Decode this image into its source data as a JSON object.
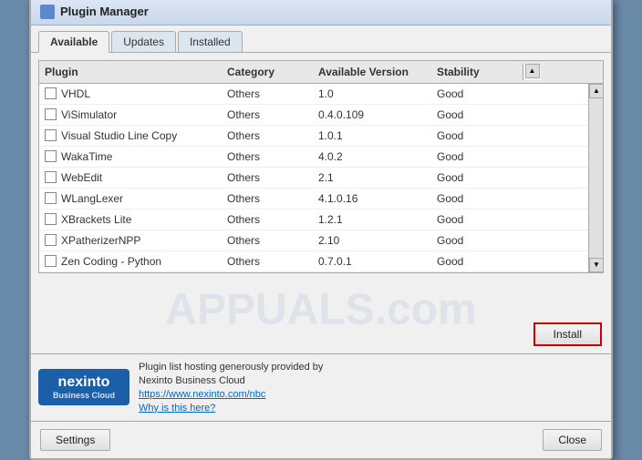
{
  "dialog": {
    "title": "Plugin Manager",
    "watermark": "APPUALS.com"
  },
  "tabs": [
    {
      "label": "Available",
      "active": true
    },
    {
      "label": "Updates",
      "active": false
    },
    {
      "label": "Installed",
      "active": false
    }
  ],
  "table": {
    "columns": [
      "Plugin",
      "Category",
      "Available Version",
      "Stability"
    ],
    "rows": [
      {
        "name": "VHDL",
        "category": "Others",
        "version": "1.0",
        "stability": "Good"
      },
      {
        "name": "ViSimulator",
        "category": "Others",
        "version": "0.4.0.109",
        "stability": "Good"
      },
      {
        "name": "Visual Studio Line Copy",
        "category": "Others",
        "version": "1.0.1",
        "stability": "Good"
      },
      {
        "name": "WakaTime",
        "category": "Others",
        "version": "4.0.2",
        "stability": "Good"
      },
      {
        "name": "WebEdit",
        "category": "Others",
        "version": "2.1",
        "stability": "Good"
      },
      {
        "name": "WLangLexer",
        "category": "Others",
        "version": "4.1.0.16",
        "stability": "Good"
      },
      {
        "name": "XBrackets Lite",
        "category": "Others",
        "version": "1.2.1",
        "stability": "Good"
      },
      {
        "name": "XPatherizerNPP",
        "category": "Others",
        "version": "2.10",
        "stability": "Good"
      },
      {
        "name": "Zen Coding - Python",
        "category": "Others",
        "version": "0.7.0.1",
        "stability": "Good"
      }
    ]
  },
  "install_button": {
    "label": "Install"
  },
  "footer": {
    "hosting_text": "Plugin list hosting generously provided by",
    "company_name": "Nexinto Business Cloud",
    "url_text": "https://www.nexinto.com/nbc",
    "why_text": "Why is this here?",
    "logo_main": "nexinto",
    "logo_sub": "Business Cloud"
  },
  "bottom_buttons": {
    "settings_label": "Settings",
    "close_label": "Close"
  }
}
